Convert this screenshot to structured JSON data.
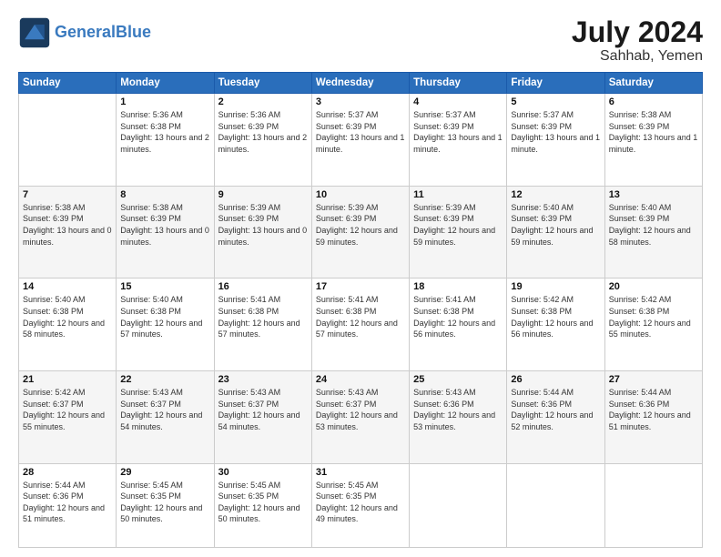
{
  "header": {
    "logo_line1": "General",
    "logo_line2": "Blue",
    "month_year": "July 2024",
    "location": "Sahhab, Yemen"
  },
  "columns": [
    "Sunday",
    "Monday",
    "Tuesday",
    "Wednesday",
    "Thursday",
    "Friday",
    "Saturday"
  ],
  "weeks": [
    [
      {
        "day": "",
        "sunrise": "",
        "sunset": "",
        "daylight": ""
      },
      {
        "day": "1",
        "sunrise": "Sunrise: 5:36 AM",
        "sunset": "Sunset: 6:38 PM",
        "daylight": "Daylight: 13 hours and 2 minutes."
      },
      {
        "day": "2",
        "sunrise": "Sunrise: 5:36 AM",
        "sunset": "Sunset: 6:39 PM",
        "daylight": "Daylight: 13 hours and 2 minutes."
      },
      {
        "day": "3",
        "sunrise": "Sunrise: 5:37 AM",
        "sunset": "Sunset: 6:39 PM",
        "daylight": "Daylight: 13 hours and 1 minute."
      },
      {
        "day": "4",
        "sunrise": "Sunrise: 5:37 AM",
        "sunset": "Sunset: 6:39 PM",
        "daylight": "Daylight: 13 hours and 1 minute."
      },
      {
        "day": "5",
        "sunrise": "Sunrise: 5:37 AM",
        "sunset": "Sunset: 6:39 PM",
        "daylight": "Daylight: 13 hours and 1 minute."
      },
      {
        "day": "6",
        "sunrise": "Sunrise: 5:38 AM",
        "sunset": "Sunset: 6:39 PM",
        "daylight": "Daylight: 13 hours and 1 minute."
      }
    ],
    [
      {
        "day": "7",
        "sunrise": "Sunrise: 5:38 AM",
        "sunset": "Sunset: 6:39 PM",
        "daylight": "Daylight: 13 hours and 0 minutes."
      },
      {
        "day": "8",
        "sunrise": "Sunrise: 5:38 AM",
        "sunset": "Sunset: 6:39 PM",
        "daylight": "Daylight: 13 hours and 0 minutes."
      },
      {
        "day": "9",
        "sunrise": "Sunrise: 5:39 AM",
        "sunset": "Sunset: 6:39 PM",
        "daylight": "Daylight: 13 hours and 0 minutes."
      },
      {
        "day": "10",
        "sunrise": "Sunrise: 5:39 AM",
        "sunset": "Sunset: 6:39 PM",
        "daylight": "Daylight: 12 hours and 59 minutes."
      },
      {
        "day": "11",
        "sunrise": "Sunrise: 5:39 AM",
        "sunset": "Sunset: 6:39 PM",
        "daylight": "Daylight: 12 hours and 59 minutes."
      },
      {
        "day": "12",
        "sunrise": "Sunrise: 5:40 AM",
        "sunset": "Sunset: 6:39 PM",
        "daylight": "Daylight: 12 hours and 59 minutes."
      },
      {
        "day": "13",
        "sunrise": "Sunrise: 5:40 AM",
        "sunset": "Sunset: 6:39 PM",
        "daylight": "Daylight: 12 hours and 58 minutes."
      }
    ],
    [
      {
        "day": "14",
        "sunrise": "Sunrise: 5:40 AM",
        "sunset": "Sunset: 6:38 PM",
        "daylight": "Daylight: 12 hours and 58 minutes."
      },
      {
        "day": "15",
        "sunrise": "Sunrise: 5:40 AM",
        "sunset": "Sunset: 6:38 PM",
        "daylight": "Daylight: 12 hours and 57 minutes."
      },
      {
        "day": "16",
        "sunrise": "Sunrise: 5:41 AM",
        "sunset": "Sunset: 6:38 PM",
        "daylight": "Daylight: 12 hours and 57 minutes."
      },
      {
        "day": "17",
        "sunrise": "Sunrise: 5:41 AM",
        "sunset": "Sunset: 6:38 PM",
        "daylight": "Daylight: 12 hours and 57 minutes."
      },
      {
        "day": "18",
        "sunrise": "Sunrise: 5:41 AM",
        "sunset": "Sunset: 6:38 PM",
        "daylight": "Daylight: 12 hours and 56 minutes."
      },
      {
        "day": "19",
        "sunrise": "Sunrise: 5:42 AM",
        "sunset": "Sunset: 6:38 PM",
        "daylight": "Daylight: 12 hours and 56 minutes."
      },
      {
        "day": "20",
        "sunrise": "Sunrise: 5:42 AM",
        "sunset": "Sunset: 6:38 PM",
        "daylight": "Daylight: 12 hours and 55 minutes."
      }
    ],
    [
      {
        "day": "21",
        "sunrise": "Sunrise: 5:42 AM",
        "sunset": "Sunset: 6:37 PM",
        "daylight": "Daylight: 12 hours and 55 minutes."
      },
      {
        "day": "22",
        "sunrise": "Sunrise: 5:43 AM",
        "sunset": "Sunset: 6:37 PM",
        "daylight": "Daylight: 12 hours and 54 minutes."
      },
      {
        "day": "23",
        "sunrise": "Sunrise: 5:43 AM",
        "sunset": "Sunset: 6:37 PM",
        "daylight": "Daylight: 12 hours and 54 minutes."
      },
      {
        "day": "24",
        "sunrise": "Sunrise: 5:43 AM",
        "sunset": "Sunset: 6:37 PM",
        "daylight": "Daylight: 12 hours and 53 minutes."
      },
      {
        "day": "25",
        "sunrise": "Sunrise: 5:43 AM",
        "sunset": "Sunset: 6:36 PM",
        "daylight": "Daylight: 12 hours and 53 minutes."
      },
      {
        "day": "26",
        "sunrise": "Sunrise: 5:44 AM",
        "sunset": "Sunset: 6:36 PM",
        "daylight": "Daylight: 12 hours and 52 minutes."
      },
      {
        "day": "27",
        "sunrise": "Sunrise: 5:44 AM",
        "sunset": "Sunset: 6:36 PM",
        "daylight": "Daylight: 12 hours and 51 minutes."
      }
    ],
    [
      {
        "day": "28",
        "sunrise": "Sunrise: 5:44 AM",
        "sunset": "Sunset: 6:36 PM",
        "daylight": "Daylight: 12 hours and 51 minutes."
      },
      {
        "day": "29",
        "sunrise": "Sunrise: 5:45 AM",
        "sunset": "Sunset: 6:35 PM",
        "daylight": "Daylight: 12 hours and 50 minutes."
      },
      {
        "day": "30",
        "sunrise": "Sunrise: 5:45 AM",
        "sunset": "Sunset: 6:35 PM",
        "daylight": "Daylight: 12 hours and 50 minutes."
      },
      {
        "day": "31",
        "sunrise": "Sunrise: 5:45 AM",
        "sunset": "Sunset: 6:35 PM",
        "daylight": "Daylight: 12 hours and 49 minutes."
      },
      {
        "day": "",
        "sunrise": "",
        "sunset": "",
        "daylight": ""
      },
      {
        "day": "",
        "sunrise": "",
        "sunset": "",
        "daylight": ""
      },
      {
        "day": "",
        "sunrise": "",
        "sunset": "",
        "daylight": ""
      }
    ]
  ]
}
